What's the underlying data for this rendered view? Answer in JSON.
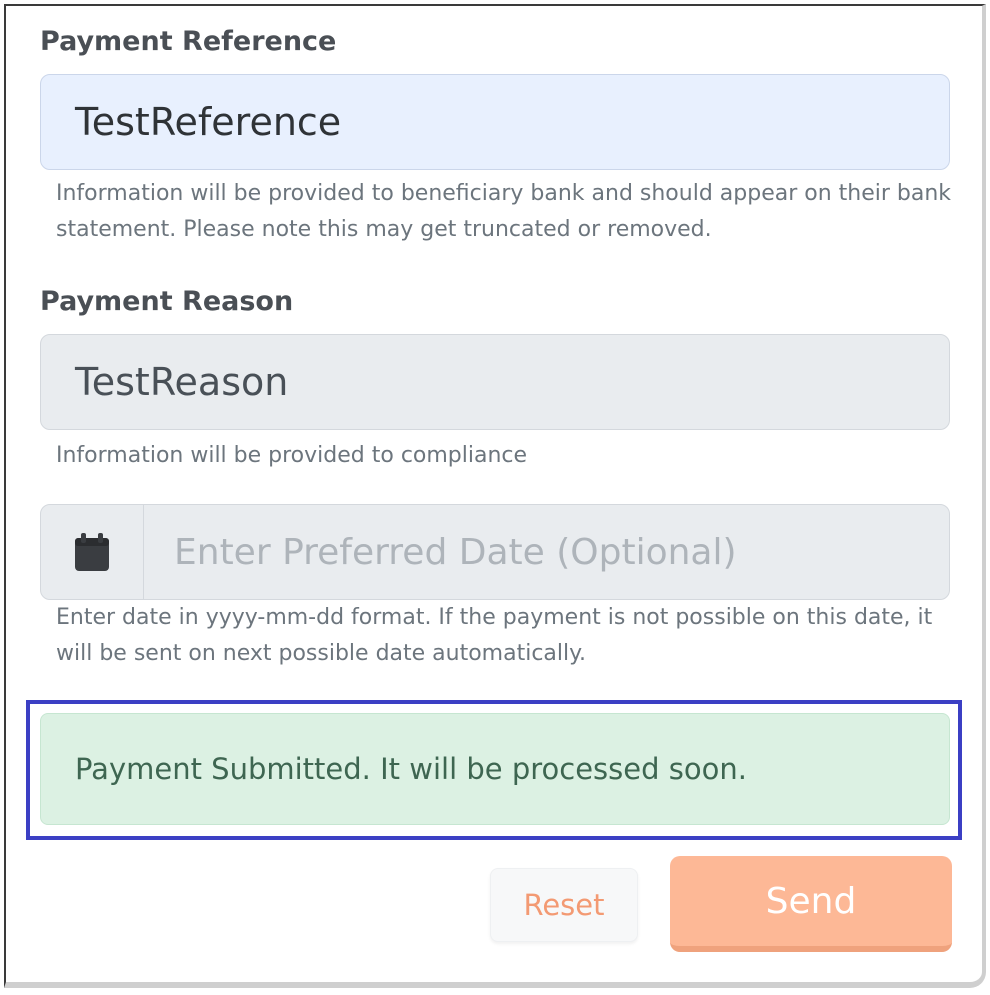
{
  "payment_reference": {
    "label": "Payment Reference",
    "value": "TestReference",
    "help": "Information will be provided to beneficiary bank and should appear on their bank statement. Please note this may get truncated or removed."
  },
  "payment_reason": {
    "label": "Payment Reason",
    "value": "TestReason",
    "help": "Information will be provided to compliance"
  },
  "preferred_date": {
    "icon": "calendar-icon",
    "value": "",
    "placeholder": "Enter Preferred Date (Optional)",
    "help": "Enter date in yyyy-mm-dd format. If the payment is not possible on this date, it will be sent on next possible date automatically."
  },
  "alert": {
    "message": "Payment Submitted. It will be processed soon."
  },
  "actions": {
    "reset_label": "Reset",
    "send_label": "Send"
  },
  "colors": {
    "accent": "#fdb896",
    "success_bg": "#dcf1e3",
    "highlight_border": "#3b3fc4"
  }
}
